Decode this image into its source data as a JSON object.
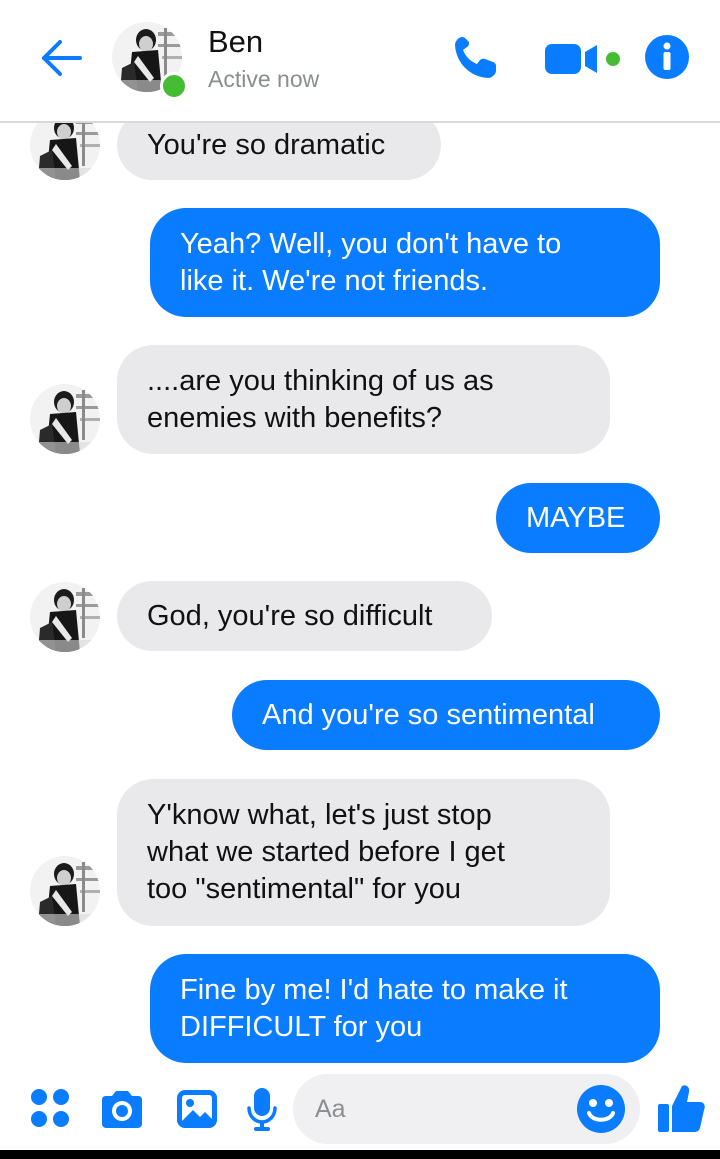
{
  "colors": {
    "accent": "#0a7cff",
    "incoming_bubble": "#e9e9eb",
    "online": "#44bd32"
  },
  "header": {
    "name": "Ben",
    "status": "Active now",
    "icons": [
      "back-arrow-icon",
      "phone-icon",
      "video-camera-icon",
      "info-icon"
    ]
  },
  "messages": [
    {
      "from": "them",
      "text": "You're so dramatic"
    },
    {
      "from": "me",
      "text": "Yeah? Well, you don't have to\nlike it. We're not friends."
    },
    {
      "from": "them",
      "text": "....are you thinking of us as\nenemies with benefits?"
    },
    {
      "from": "me",
      "text": "MAYBE"
    },
    {
      "from": "them",
      "text": "God, you're so difficult"
    },
    {
      "from": "me",
      "text": "And you're so sentimental"
    },
    {
      "from": "them",
      "text": "Y'know what, let's just stop\nwhat we started before I get\ntoo \"sentimental\" for you"
    },
    {
      "from": "me",
      "text": "Fine by me! I'd hate to make it\nDIFFICULT for you"
    }
  ],
  "composer": {
    "placeholder": "Aa",
    "icons": [
      "more-options-icon",
      "camera-icon",
      "gallery-icon",
      "microphone-icon",
      "emoji-icon",
      "thumbs-up-icon"
    ]
  }
}
